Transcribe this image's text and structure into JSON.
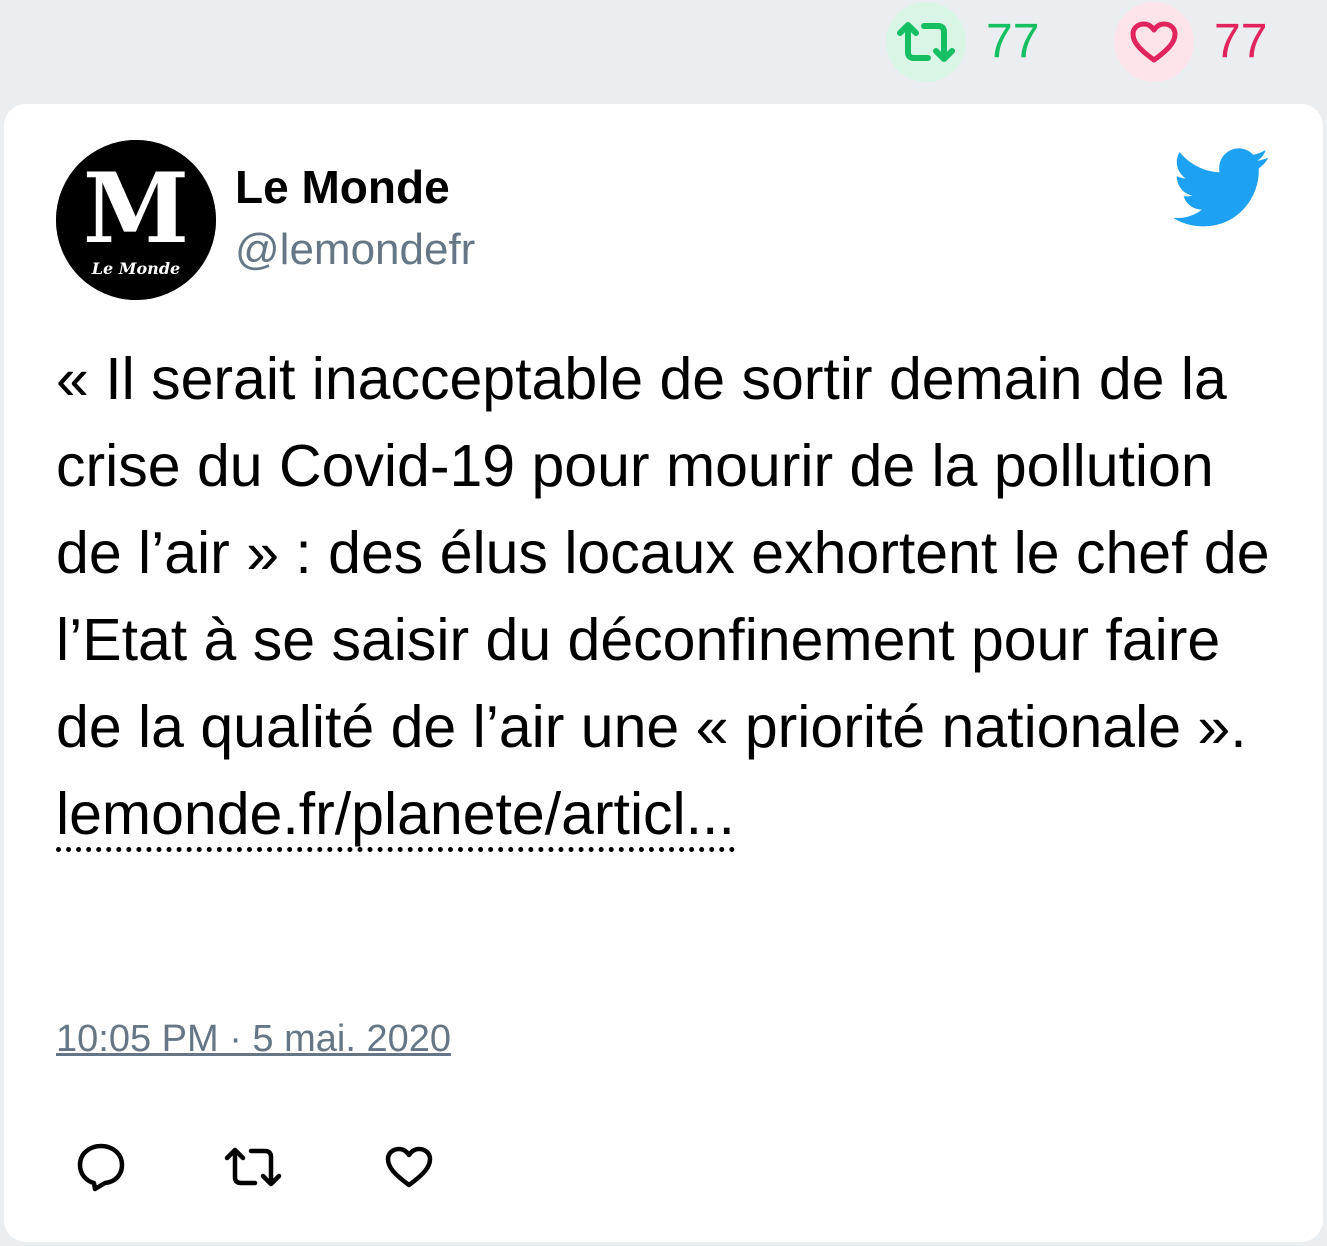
{
  "top_stats": {
    "retweet_count": "77",
    "like_count": "77"
  },
  "author": {
    "name": "Le Monde",
    "handle": "@lemondefr",
    "avatar_mark": "M",
    "avatar_caption": "Le Monde"
  },
  "tweet": {
    "text": "« Il serait inacceptable de sortir demain de la crise du Covid-19 pour mourir de la pollution de l’air » : des élus locaux exhortent le chef de l’Etat à se saisir du déconfinement pour faire de la qualité de l’air une « priorité nationale ». ",
    "link_text": "lemonde.fr/planete/articl...",
    "timestamp": "10:05 PM · 5 mai. 2020"
  },
  "icons": {
    "retweet": "retweet-icon",
    "like": "heart-icon",
    "reply": "reply-icon",
    "brand": "twitter-bird-icon"
  },
  "colors": {
    "retweet": "#17bf63",
    "like": "#e0245e",
    "muted": "#657786",
    "brand": "#1da1f2"
  }
}
